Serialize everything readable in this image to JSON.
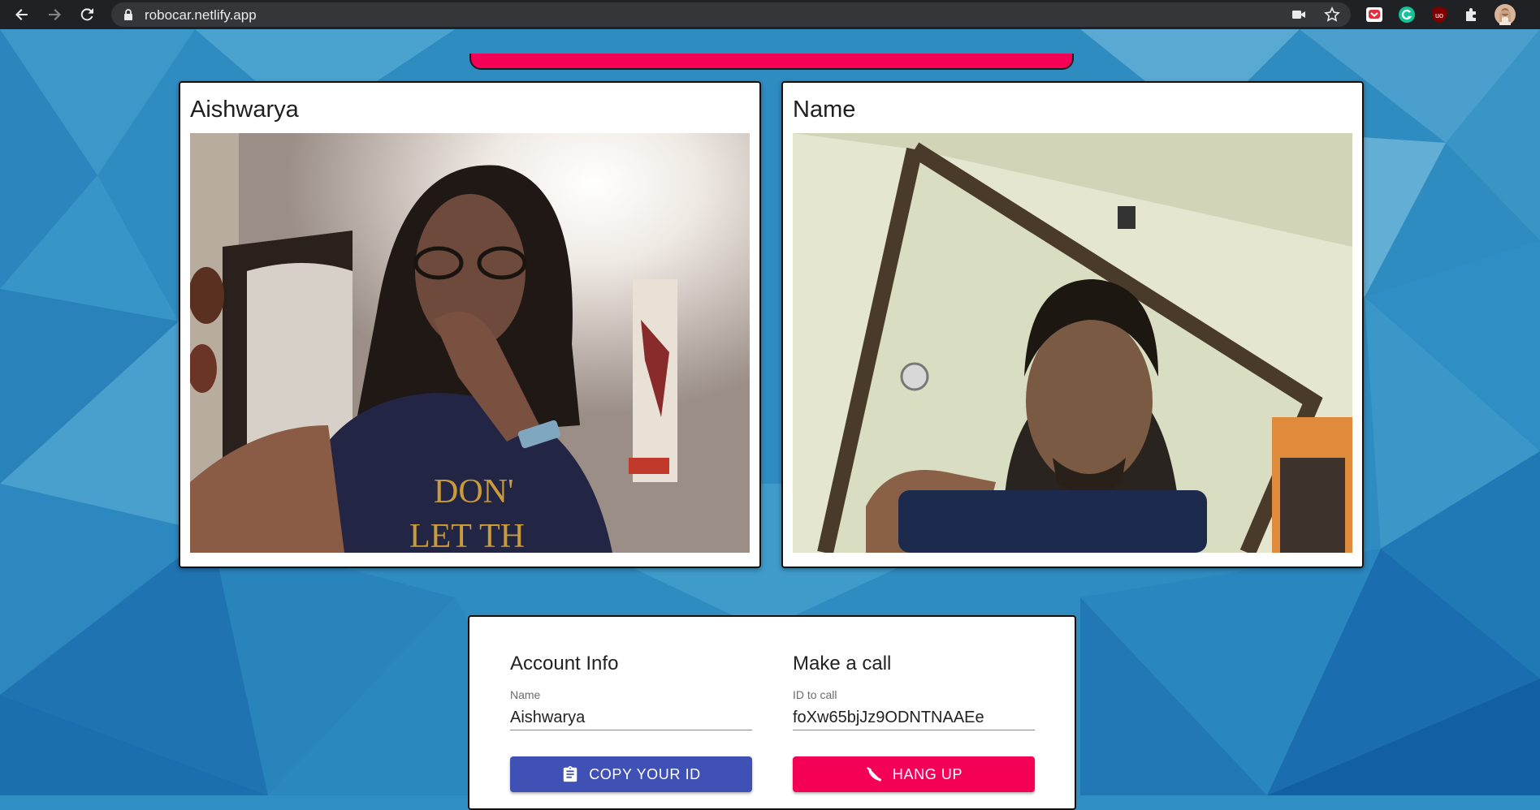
{
  "browser": {
    "url": "robocar.netlify.app",
    "icons": [
      "back-icon",
      "forward-icon",
      "reload-icon",
      "lock-icon",
      "camera-icon",
      "star-icon",
      "extension-pocket-icon",
      "extension-grammarly-icon",
      "extension-ublock-icon",
      "extensions-puzzle-icon",
      "profile-avatar"
    ]
  },
  "videos": {
    "local": {
      "name": "Aishwarya"
    },
    "remote": {
      "name": "Name"
    }
  },
  "account": {
    "heading": "Account Info",
    "name_label": "Name",
    "name_value": "Aishwarya",
    "copy_label": "COPY YOUR ID"
  },
  "call": {
    "heading": "Make a call",
    "id_label": "ID to call",
    "id_value": "foXw65bjJz9ODNTNAAEe",
    "hangup_label": "HANG UP"
  },
  "colors": {
    "primary": "#3f51b5",
    "secondary": "#f50057",
    "background": "#2f8fc4"
  }
}
